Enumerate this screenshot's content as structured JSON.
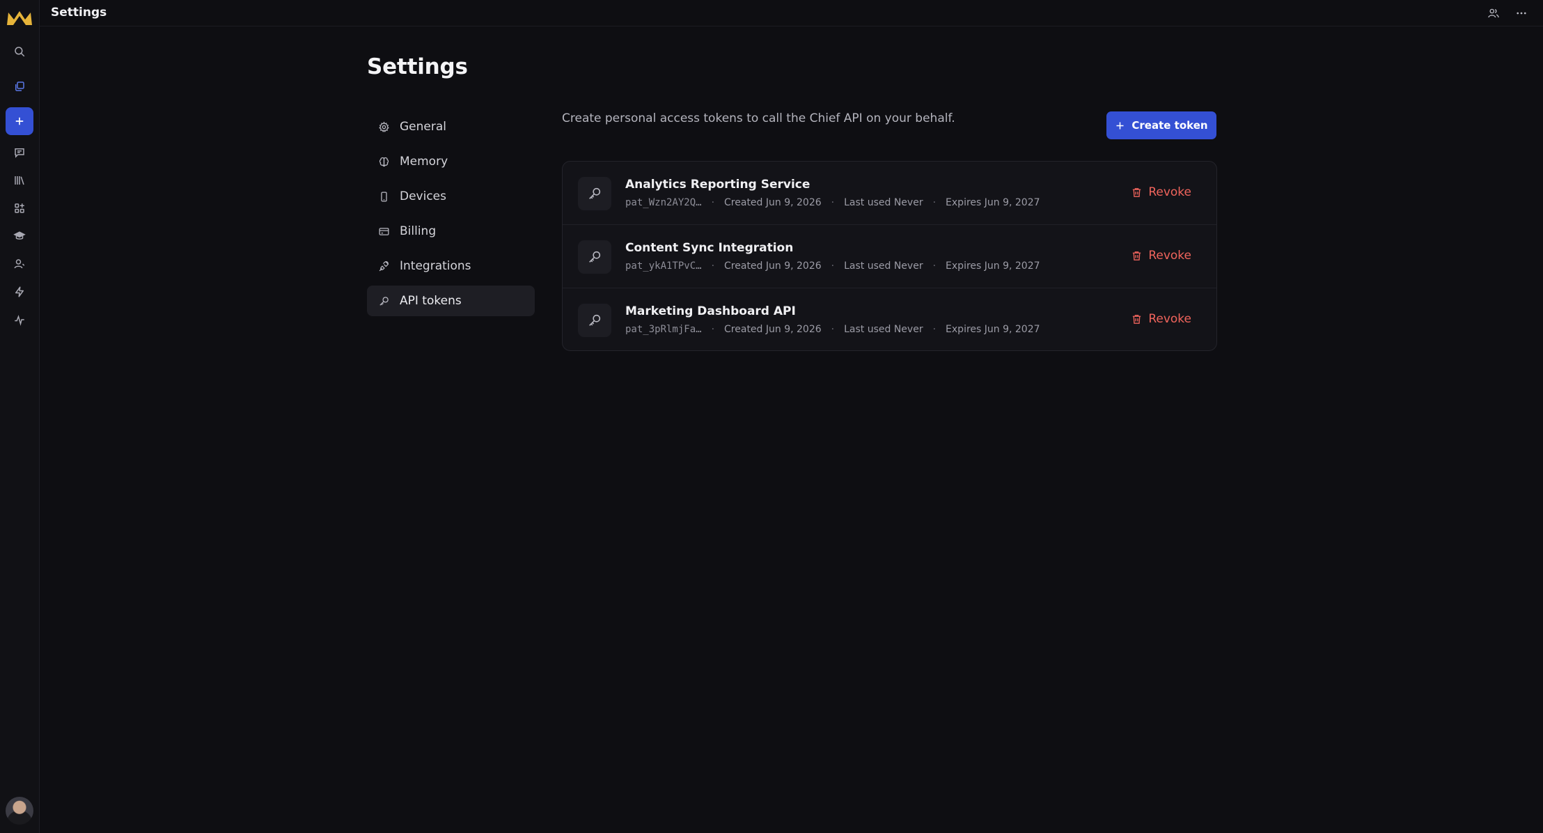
{
  "app": {
    "title": "Settings"
  },
  "colors": {
    "accent": "#3450d4",
    "danger": "#f0645c",
    "logo": "#e6b43a"
  },
  "rail": {
    "items": [
      {
        "icon": "search-icon"
      },
      {
        "icon": "documents-icon"
      },
      {
        "icon": "plus-icon"
      },
      {
        "icon": "chat-icon"
      },
      {
        "icon": "library-icon"
      },
      {
        "icon": "apps-icon"
      },
      {
        "icon": "graduation-cap-icon"
      },
      {
        "icon": "user-icon"
      },
      {
        "icon": "lightning-icon"
      },
      {
        "icon": "activity-icon"
      }
    ]
  },
  "page": {
    "title": "Settings"
  },
  "nav": {
    "items": [
      {
        "label": "General",
        "icon": "gear-icon"
      },
      {
        "label": "Memory",
        "icon": "brain-icon"
      },
      {
        "label": "Devices",
        "icon": "phone-icon"
      },
      {
        "label": "Billing",
        "icon": "credit-card-icon"
      },
      {
        "label": "Integrations",
        "icon": "plug-icon"
      },
      {
        "label": "API tokens",
        "icon": "key-icon",
        "active": true
      }
    ]
  },
  "main": {
    "intro": "Create personal access tokens to call the Chief API on your behalf.",
    "create_label": "Create token",
    "tokens": [
      {
        "name": "Analytics Reporting Service",
        "prefix": "pat_Wzn2AY2Q…",
        "created": "Created Jun 9, 2026",
        "last_used": "Last used Never",
        "expires": "Expires Jun 9, 2027",
        "revoke_label": "Revoke"
      },
      {
        "name": "Content Sync Integration",
        "prefix": "pat_ykA1TPvC…",
        "created": "Created Jun 9, 2026",
        "last_used": "Last used Never",
        "expires": "Expires Jun 9, 2027",
        "revoke_label": "Revoke"
      },
      {
        "name": "Marketing Dashboard API",
        "prefix": "pat_3pRlmjFa…",
        "created": "Created Jun 9, 2026",
        "last_used": "Last used Never",
        "expires": "Expires Jun 9, 2027",
        "revoke_label": "Revoke"
      }
    ]
  }
}
